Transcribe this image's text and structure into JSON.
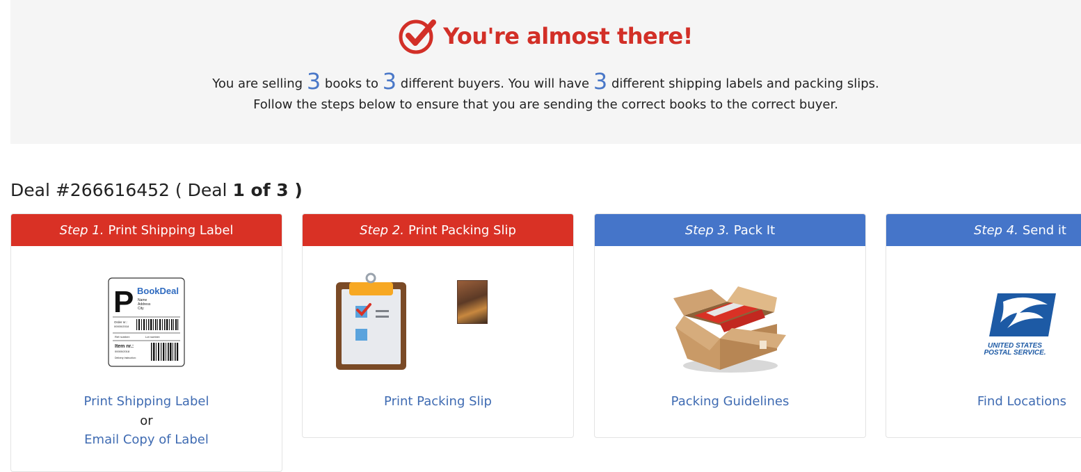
{
  "banner": {
    "headline": "You're almost there!",
    "line1_part1": "You are selling",
    "books_count": "3",
    "line1_part2": "books to",
    "buyers_count": "3",
    "line1_part3": "different buyers. You will have",
    "labels_count": "3",
    "line1_part4": "different shipping labels and packing slips.",
    "line2": "Follow the steps below to ensure that you are sending the correct books to the correct buyer."
  },
  "deal": {
    "prefix": "Deal #266616452 ( Deal ",
    "position": "1 of 3",
    "suffix": " )"
  },
  "steps": [
    {
      "step": "Step 1.",
      "title": "Print Shipping Label",
      "link": "Print Shipping Label",
      "or": "or",
      "link2": "Email Copy of Label",
      "color": "#d93125"
    },
    {
      "step": "Step 2.",
      "title": "Print Packing Slip",
      "link": "Print Packing Slip",
      "color": "#d93125"
    },
    {
      "step": "Step 3.",
      "title": "Pack It",
      "link": "Packing Guidelines",
      "color": "#4575c9"
    },
    {
      "step": "Step 4.",
      "title": "Send it",
      "link": "Find Locations",
      "color": "#4575c9"
    }
  ],
  "label_illustration": {
    "big_letter": "P",
    "brand": "BookDeal",
    "name": "Name",
    "address": "Address",
    "city": "City",
    "order_nr": "Order nr.:",
    "order_val": "00000/2018",
    "ref": "Ref number:",
    "lot": "Lot number:",
    "item": "Item nr.:",
    "item_val": "00000/2018",
    "delivery": "Delivery Instruction:"
  },
  "usps": {
    "line1": "UNITED STATES",
    "line2": "POSTAL SERVICE."
  },
  "colors": {
    "accent_red": "#d22f27",
    "accent_blue": "#4a78c8",
    "link": "#3f6bb2"
  }
}
